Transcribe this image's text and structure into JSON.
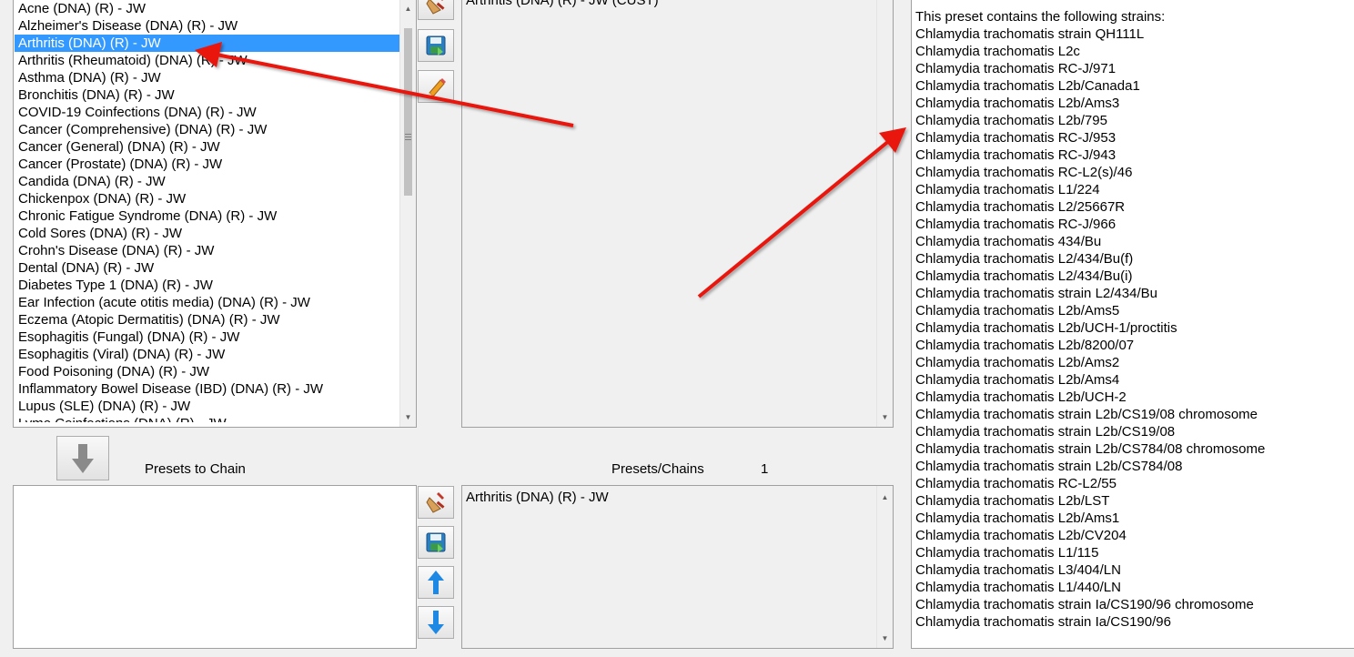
{
  "preset_list": {
    "top_partial": "..",
    "items": [
      "Acne (DNA) (R) - JW",
      "Alzheimer's Disease (DNA) (R) - JW",
      "Arthritis (DNA) (R) - JW",
      "Arthritis (Rheumatoid) (DNA) (R) - JW",
      "Asthma (DNA) (R) - JW",
      "Bronchitis (DNA) (R) - JW",
      "COVID-19 Coinfections (DNA) (R) - JW",
      "Cancer (Comprehensive) (DNA) (R) - JW",
      "Cancer (General) (DNA) (R) - JW",
      "Cancer (Prostate) (DNA) (R) - JW",
      "Candida (DNA) (R) - JW",
      "Chickenpox (DNA) (R) - JW",
      "Chronic Fatigue Syndrome (DNA) (R) - JW",
      "Cold Sores (DNA) (R) - JW",
      "Crohn's Disease (DNA) (R) - JW",
      "Dental (DNA) (R) - JW",
      "Diabetes Type 1 (DNA) (R) - JW",
      "Ear Infection (acute otitis media) (DNA) (R) - JW",
      "Eczema (Atopic Dermatitis) (DNA) (R) - JW",
      "Esophagitis (Fungal) (DNA) (R) - JW",
      "Esophagitis (Viral) (DNA) (R) - JW",
      "Food Poisoning (DNA) (R) - JW",
      "Inflammatory Bowel Disease (IBD) (DNA) (R) - JW",
      "Lupus (SLE) (DNA) (R) - JW"
    ],
    "bottom_partial": "Lyme Coinfections (DNA) (R) - JW",
    "selected_index": 2
  },
  "top_middle_panel": {
    "partial_text": "Arthritis (DNA) (R) - JW (CUST)"
  },
  "chain_section": {
    "presets_to_chain_label": "Presets to Chain",
    "presets_chains_label": "Presets/Chains",
    "presets_chains_count": "1",
    "chain_items": [
      "Arthritis (DNA) (R) - JW"
    ]
  },
  "strain_info": {
    "header": "This preset contains the following strains:",
    "strains": [
      "Chlamydia trachomatis strain QH111L",
      "Chlamydia trachomatis L2c",
      "Chlamydia trachomatis RC-J/971",
      "Chlamydia trachomatis L2b/Canada1",
      "Chlamydia trachomatis L2b/Ams3",
      "Chlamydia trachomatis L2b/795",
      "Chlamydia trachomatis RC-J/953",
      "Chlamydia trachomatis RC-J/943",
      "Chlamydia trachomatis RC-L2(s)/46",
      "Chlamydia trachomatis L1/224",
      "Chlamydia trachomatis L2/25667R",
      "Chlamydia trachomatis RC-J/966",
      "Chlamydia trachomatis 434/Bu",
      "Chlamydia trachomatis L2/434/Bu(f)",
      "Chlamydia trachomatis L2/434/Bu(i)",
      "Chlamydia trachomatis strain L2/434/Bu",
      "Chlamydia trachomatis L2b/Ams5",
      "Chlamydia trachomatis L2b/UCH-1/proctitis",
      "Chlamydia trachomatis L2b/8200/07",
      "Chlamydia trachomatis L2b/Ams2",
      "Chlamydia trachomatis L2b/Ams4",
      "Chlamydia trachomatis L2b/UCH-2",
      "Chlamydia trachomatis strain L2b/CS19/08 chromosome",
      "Chlamydia trachomatis strain L2b/CS19/08",
      "Chlamydia trachomatis strain L2b/CS784/08 chromosome",
      "Chlamydia trachomatis strain L2b/CS784/08",
      "Chlamydia trachomatis RC-L2/55",
      "Chlamydia trachomatis L2b/LST",
      "Chlamydia trachomatis L2b/Ams1",
      "Chlamydia trachomatis L2b/CV204",
      "Chlamydia trachomatis L1/115",
      "Chlamydia trachomatis L3/404/LN",
      "Chlamydia trachomatis L1/440/LN",
      "Chlamydia trachomatis strain Ia/CS190/96 chromosome",
      "Chlamydia trachomatis strain Ia/CS190/96"
    ]
  },
  "icons": {
    "clear_top": "clear-broom-icon",
    "save_top": "save-disk-icon",
    "edit_top": "edit-pencil-icon",
    "add_to_chain": "arrow-down-icon",
    "clear_bottom": "clear-broom-icon",
    "save_bottom": "save-disk-icon",
    "move_up": "arrow-up-icon",
    "move_down": "arrow-down-icon"
  },
  "colors": {
    "selection": "#3399ff",
    "annotation_arrow": "#e8140c",
    "nav_arrow_blue": "#1e88e5"
  }
}
